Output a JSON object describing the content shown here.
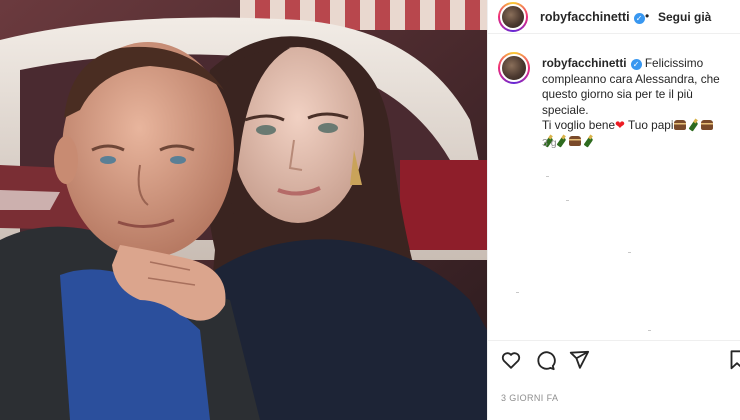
{
  "post": {
    "username": "robyfacchinetti",
    "verified_mark": "✓",
    "separator": "•",
    "follow_label": "Segui già",
    "caption": {
      "username": "robyfacchinetti",
      "line1": "Felicissimo",
      "line2": "compleanno cara Alessandra, che",
      "line3": "questo giorno sia per te il più speciale.",
      "line4a": "Ti voglio bene",
      "line4b": "Tuo papi",
      "time": "3 g"
    },
    "timestamp": "3 GIORNI FA"
  },
  "icons": {
    "like": "heart-icon",
    "comment": "comment-icon",
    "share": "paper-plane-icon",
    "save": "bookmark-icon",
    "verified": "verified-badge-icon"
  },
  "colors": {
    "verified": "#3897f0",
    "text": "#262626",
    "muted": "#8e8e8e",
    "heart": "#ed1c24"
  }
}
